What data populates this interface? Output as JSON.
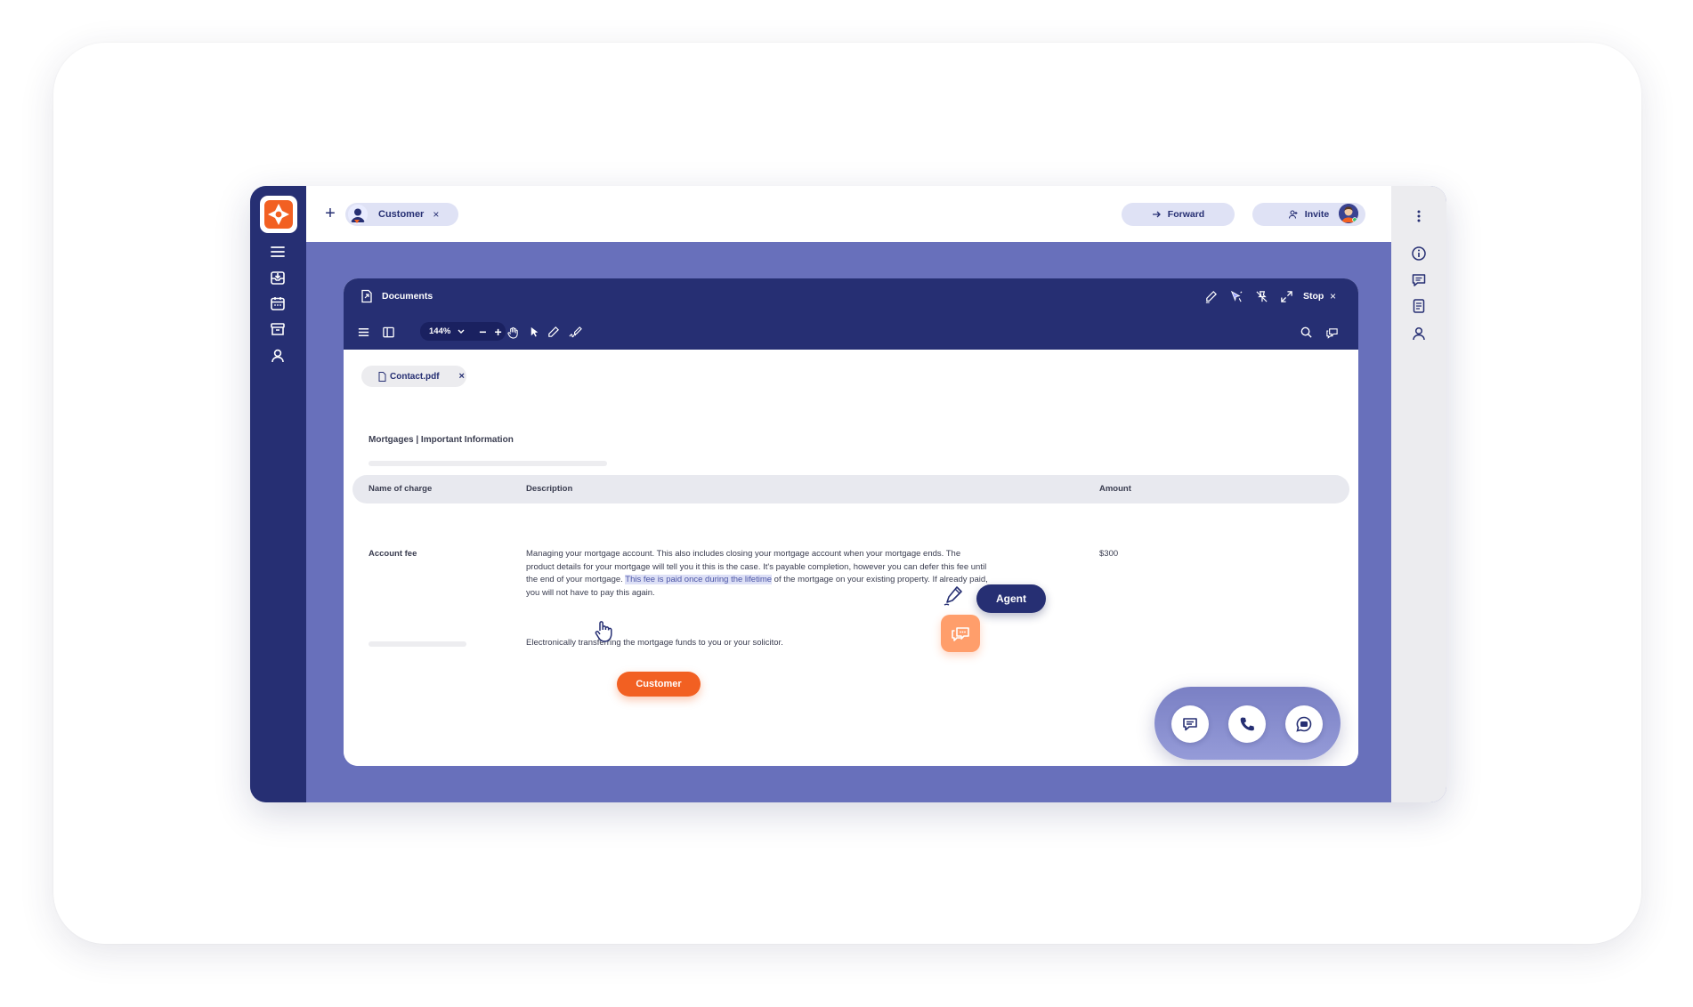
{
  "topbar": {
    "customer_chip_label": "Customer",
    "customer_chip_close": "×",
    "add_label": "+",
    "forward_label": "Forward",
    "invite_label": "Invite"
  },
  "documents": {
    "title": "Documents",
    "stop_label": "Stop",
    "stop_close": "×",
    "zoom_value": "144%",
    "zoom_minus": "−",
    "zoom_plus": "+",
    "file_tab": {
      "name": "Contact.pdf",
      "close": "×"
    },
    "heading": "Mortgages | Important Information",
    "table": {
      "headers": [
        "Name of charge",
        "Description",
        "Amount"
      ],
      "rows": [
        {
          "name": "Account fee",
          "description_before": "Managing your mortgage account. This also includes closing your mortgage account when your mortgage ends. The product details for your mortgage will tell you it this is the case. It's payable completion, however you can defer this fee until the end of your mortgage. ",
          "description_highlight": "This fee is paid once during the lifetime",
          "description_after": " of the mortgage on your existing property. If already paid, you will not have to pay this again.",
          "amount": "$300"
        },
        {
          "name": "",
          "description": "Electronically transferring the mortgage funds to you or your solicitor.",
          "amount": ""
        }
      ]
    }
  },
  "cursors": {
    "agent_label": "Agent",
    "customer_label": "Customer"
  },
  "colors": {
    "navy": "#262f73",
    "periwinkle": "#6870bb",
    "orange": "#f26022",
    "peach": "#ff9e6b",
    "chip_bg": "#dfe2f5"
  },
  "icons": {
    "left_rail": [
      "menu-icon",
      "inbox-icon",
      "calendar-icon",
      "archive-icon",
      "user-icon"
    ],
    "right_rail": [
      "more-vertical-icon",
      "info-icon",
      "chat-icon",
      "document-icon",
      "user-icon"
    ],
    "doc_header_tools": [
      "pen-icon",
      "pointer-sparkle-icon",
      "pin-off-icon",
      "expand-icon"
    ],
    "doc_toolbar_tools": [
      "menu-icon",
      "sidebar-panel-icon",
      "hand-icon",
      "pointer-icon",
      "pen-icon",
      "signature-icon",
      "search-icon",
      "comments-icon"
    ],
    "dock": [
      "message-icon",
      "phone-icon",
      "chat-bubble-icon"
    ]
  }
}
